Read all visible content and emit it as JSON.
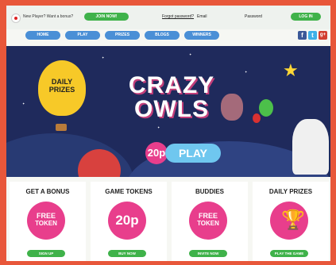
{
  "topbar": {
    "new_player_text": "New Player? Want a bonus?",
    "join_label": "JOIN NOW!",
    "forgot_label": "Forgot password?",
    "email_label": "Email",
    "password_label": "Password",
    "login_label": "LOG IN"
  },
  "nav": {
    "items": [
      "HOME",
      "PLAY",
      "PRIZES",
      "BLOGS",
      "WINNERS"
    ]
  },
  "social": [
    "f",
    "t",
    "g+"
  ],
  "hero": {
    "balloon_text_1": "DAILY",
    "balloon_text_2": "PRIZES",
    "title_1": "CRAZY",
    "title_2": "OWLS",
    "price": "20p",
    "play_label": "PLAY"
  },
  "cards": [
    {
      "title": "GET A BONUS",
      "circle_line1": "FREE",
      "circle_line2": "TOKEN",
      "button": "SIGN UP"
    },
    {
      "title": "GAME TOKENS",
      "circle_num": "20p",
      "button": "BUY NOW"
    },
    {
      "title": "BUDDIES",
      "circle_line1": "FREE",
      "circle_line2": "TOKEN",
      "button": "INVITE NOW"
    },
    {
      "title": "DAILY PRIZES",
      "button": "PLAY THE GAME"
    }
  ],
  "colors": {
    "accent_green": "#3fb24a",
    "accent_pink": "#e83e8c",
    "nav_blue": "#4a8fd6",
    "border": "#e8573a"
  }
}
